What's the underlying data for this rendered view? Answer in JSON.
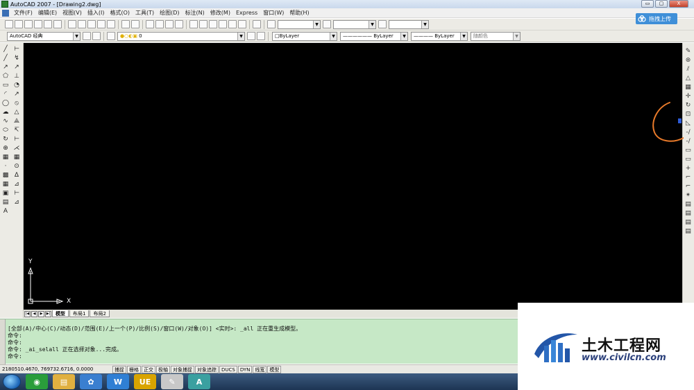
{
  "window": {
    "title": "AutoCAD 2007 - [Drawing2.dwg]",
    "buttons": [
      "▭",
      "▢",
      "X"
    ]
  },
  "menu": {
    "items": [
      "文件(F)",
      "编辑(E)",
      "视图(V)",
      "插入(I)",
      "格式(O)",
      "工具(T)",
      "绘图(D)",
      "标注(N)",
      "修改(M)",
      "Express",
      "窗口(W)",
      "帮助(H)"
    ]
  },
  "cloud": {
    "label": "拖拽上传",
    "color": "#3f8fd8"
  },
  "toolbar2": {
    "workspace": "AutoCAD 经典",
    "layer": "0",
    "color": "ByLayer",
    "linetype": "ByLayer",
    "lineweight": "ByLayer",
    "plotstyle": "随颜色"
  },
  "canvas": {
    "background": "#000000",
    "axis_x": "X",
    "axis_y": "Y"
  },
  "tabs": {
    "nav": [
      "|◀",
      "◀",
      "▶",
      "▶|"
    ],
    "items": [
      "模型",
      "布局1",
      "布局2"
    ],
    "active": "模型"
  },
  "command": {
    "lines": [
      "[全部(A)/中心(C)/动态(D)/范围(E)/上一个(P)/比例(S)/窗口(W)/对象(O)] <实时>: _all 正在重生成模型。",
      "命令:",
      "命令:",
      "命令: _ai_selall 正在选择对象...完成。",
      "命令:"
    ],
    "background": "#c6e8c6"
  },
  "status": {
    "coords": "2180510.4670, 769732.6716, 0.0000",
    "toggles": [
      "捕捉",
      "栅格",
      "正交",
      "极轴",
      "对象捕捉",
      "对象追踪",
      "DUCS",
      "DYN",
      "线宽",
      "模型"
    ]
  },
  "taskbar": {
    "apps": [
      {
        "icon": "browser-icon",
        "glyph": "◉",
        "color": "#2a9d3b"
      },
      {
        "icon": "folder-icon",
        "glyph": "▤",
        "color": "#e0b040"
      },
      {
        "icon": "cloud-icon",
        "glyph": "✿",
        "color": "#3a7fd0"
      },
      {
        "icon": "wps-icon",
        "glyph": "W",
        "color": "#2f7fd4"
      },
      {
        "icon": "ue-icon",
        "glyph": "UE",
        "color": "#d9a400"
      },
      {
        "icon": "paint-icon",
        "glyph": "✎",
        "color": "#c8c8c8"
      },
      {
        "icon": "autocad-icon",
        "glyph": "A",
        "color": "#3aa0a0"
      }
    ]
  },
  "watermark": {
    "brand": "土木工程网",
    "url": "www.civilcn.com"
  },
  "left_tools": {
    "col1": [
      "╱",
      "╱",
      "↗",
      "⬠",
      "▭",
      "◜",
      "◯",
      "☁",
      "∿",
      "⬭",
      "↻",
      "⊕",
      "▦",
      "·",
      "▩",
      "▦",
      "▣",
      "▤",
      "A"
    ],
    "col2": [
      "⊢",
      "↯",
      "↗",
      "⊥",
      "◔",
      "↗",
      "⦸",
      "△",
      "⟁",
      "↸",
      "⊢",
      "⋌",
      "▦",
      "⊙",
      "Δ",
      "⊿",
      "⊢",
      "⊿"
    ]
  },
  "right_tools": [
    "✎",
    "⊛",
    "⫽",
    "△",
    "▦",
    "✛",
    "↻",
    "⊡",
    "◺",
    "-/",
    "-/",
    "▭",
    "▭",
    "+",
    "⌐",
    "⌐",
    "✴",
    "▤",
    "▤",
    "▤",
    "▤"
  ]
}
